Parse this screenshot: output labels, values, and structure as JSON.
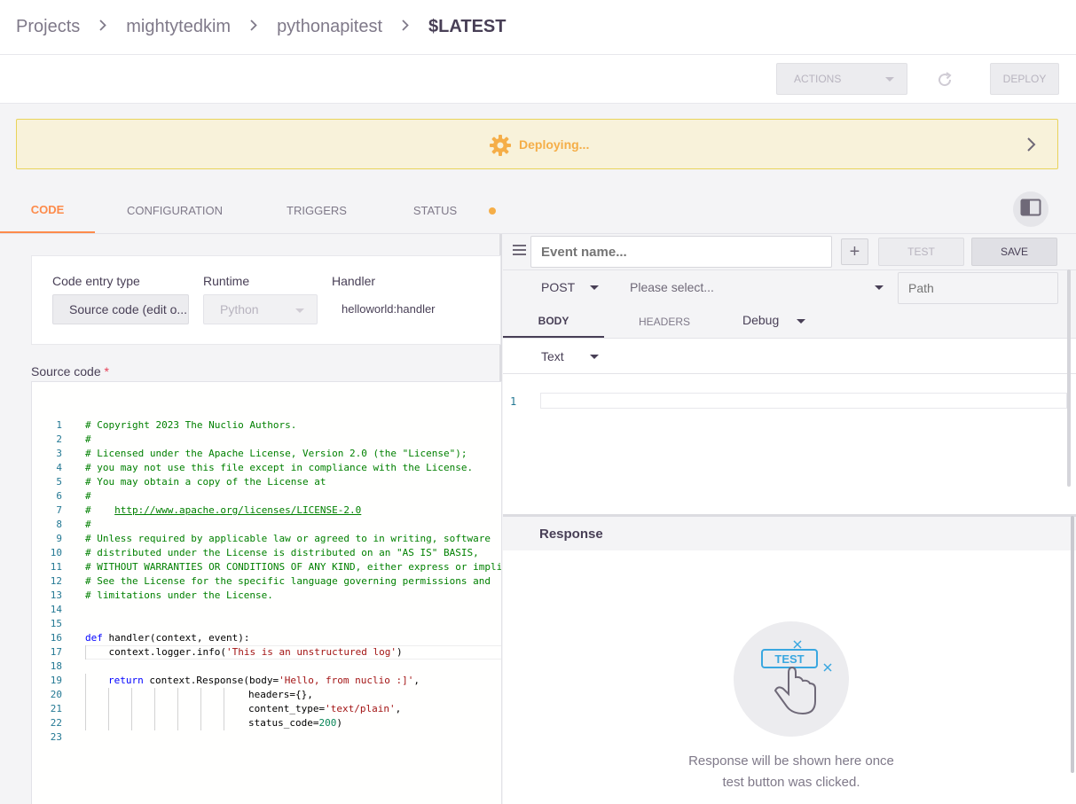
{
  "breadcrumb": {
    "items": [
      "Projects",
      "mightytedkim",
      "pythonapitest"
    ],
    "current": "$LATEST"
  },
  "toolbar": {
    "actions_label": "ACTIONS",
    "deploy_label": "DEPLOY"
  },
  "banner": {
    "text": "Deploying..."
  },
  "tabs": {
    "code": "CODE",
    "configuration": "CONFIGURATION",
    "triggers": "TRIGGERS",
    "status": "STATUS"
  },
  "code_panel": {
    "entry_type_label": "Code entry type",
    "entry_type_value": "Source code (edit o...",
    "runtime_label": "Runtime",
    "runtime_value": "Python",
    "handler_label": "Handler",
    "handler_value": "helloworld:handler",
    "source_label": "Source code",
    "required_mark": "*"
  },
  "code": {
    "line_numbers": [
      "1",
      "2",
      "3",
      "4",
      "5",
      "6",
      "7",
      "8",
      "9",
      "10",
      "11",
      "12",
      "13",
      "14",
      "15",
      "16",
      "17",
      "18",
      "19",
      "20",
      "21",
      "22",
      "23"
    ],
    "l1": "# Copyright 2023 The Nuclio Authors.",
    "l2": "#",
    "l3": "# Licensed under the Apache License, Version 2.0 (the \"License\");",
    "l4": "# you may not use this file except in compliance with the License.",
    "l5": "# You may obtain a copy of the License at",
    "l6": "#",
    "l7a": "#    ",
    "l7b": "http://www.apache.org/licenses/LICENSE-2.0",
    "l8": "#",
    "l9": "# Unless required by applicable law or agreed to in writing, software",
    "l10": "# distributed under the License is distributed on an \"AS IS\" BASIS,",
    "l11": "# WITHOUT WARRANTIES OR CONDITIONS OF ANY KIND, either express or implied.",
    "l12": "# See the License for the specific language governing permissions and",
    "l13": "# limitations under the License.",
    "l16_kw": "def",
    "l16_rest": " handler(context, event):",
    "l17_a": "    context.logger.info(",
    "l17_str": "'This is an unstructured log'",
    "l17_b": ")",
    "l19_kw": "return",
    "l19_a": " context.Response(body=",
    "l19_str": "'Hello, from nuclio :]'",
    "l19_b": ",",
    "l20": "headers={},",
    "l21_a": "content_type=",
    "l21_str": "'text/plain'",
    "l21_b": ",",
    "l22_a": "status_code=",
    "l22_num": "200",
    "l22_b": ")"
  },
  "test_panel": {
    "event_placeholder": "Event name...",
    "add_label": "+",
    "test_label": "TEST",
    "save_label": "SAVE",
    "method": "POST",
    "url_placeholder": "Please select...",
    "path_placeholder": "Path",
    "body_tab": "BODY",
    "headers_tab": "HEADERS",
    "log_level": "Debug",
    "body_type": "Text",
    "body_line_number": "1",
    "response_title": "Response",
    "test_badge": "TEST",
    "response_message_1": "Response will be shown here once",
    "response_message_2": "test button was clicked."
  },
  "colors": {
    "accent": "#fd8b4b",
    "warning": "#f5ae48",
    "banner_bg": "#f8f2da",
    "comment": "#008000",
    "keyword": "#0000ff",
    "string": "#a31515",
    "number": "#098658",
    "test_icon": "#3aa7e0"
  }
}
